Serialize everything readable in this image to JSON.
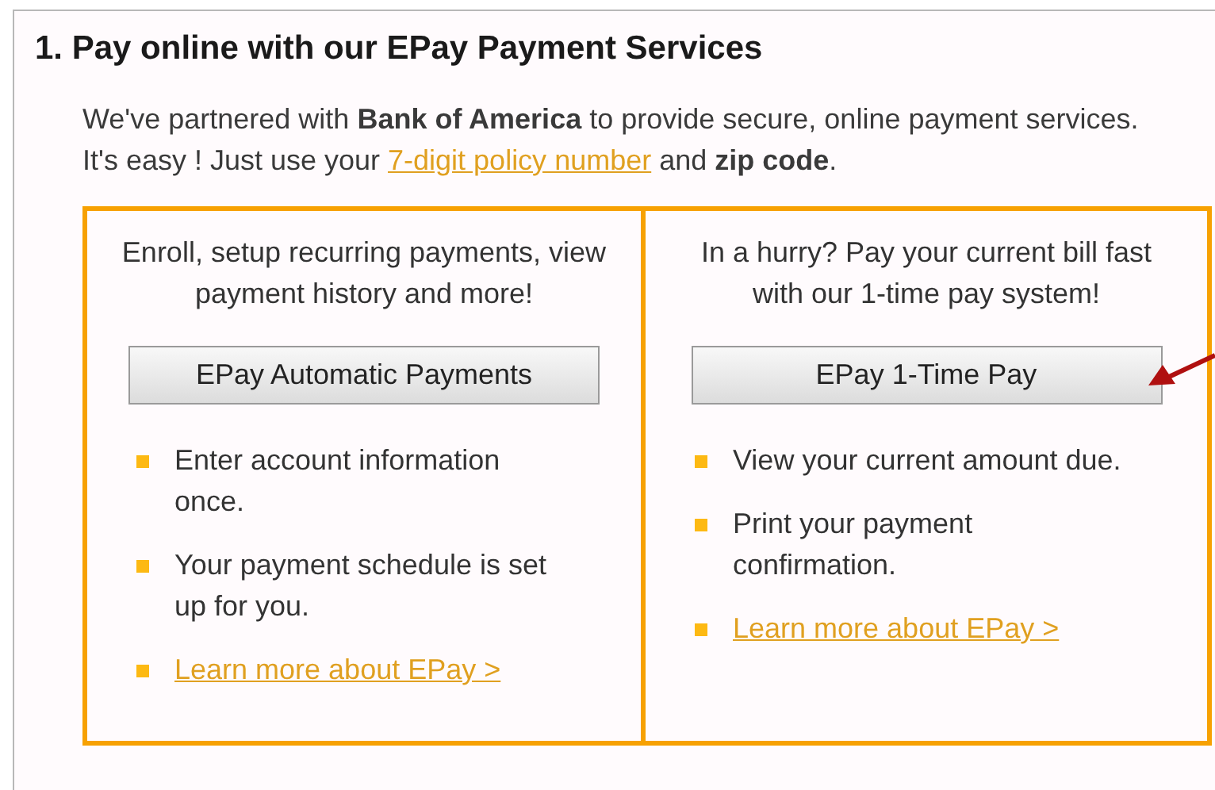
{
  "section": {
    "title": "1. Pay online with our EPay Payment Services",
    "intro": {
      "before": "We've partnered with **Bank of America** to provide secure, online payment services. It's easy ! Just use your ",
      "link": "7-digit policy number",
      "after": " and **zip code**."
    },
    "options": [
      {
        "description": "Enroll, setup recurring payments, view payment history and more!",
        "button": "EPay Automatic Payments",
        "items": [
          {
            "kind": "text",
            "text": "Enter account information once."
          },
          {
            "kind": "text",
            "text": "Your payment schedule is set up for you."
          },
          {
            "kind": "link",
            "text": "Learn more about EPay >"
          }
        ]
      },
      {
        "description": "In a hurry? Pay your current bill fast with our 1-time pay system!",
        "button": "EPay 1-Time Pay",
        "items": [
          {
            "kind": "text",
            "text": "View your current amount due."
          },
          {
            "kind": "text",
            "text": "Print your payment confirmation."
          },
          {
            "kind": "link",
            "text": "Learn more about EPay >"
          }
        ]
      }
    ]
  }
}
